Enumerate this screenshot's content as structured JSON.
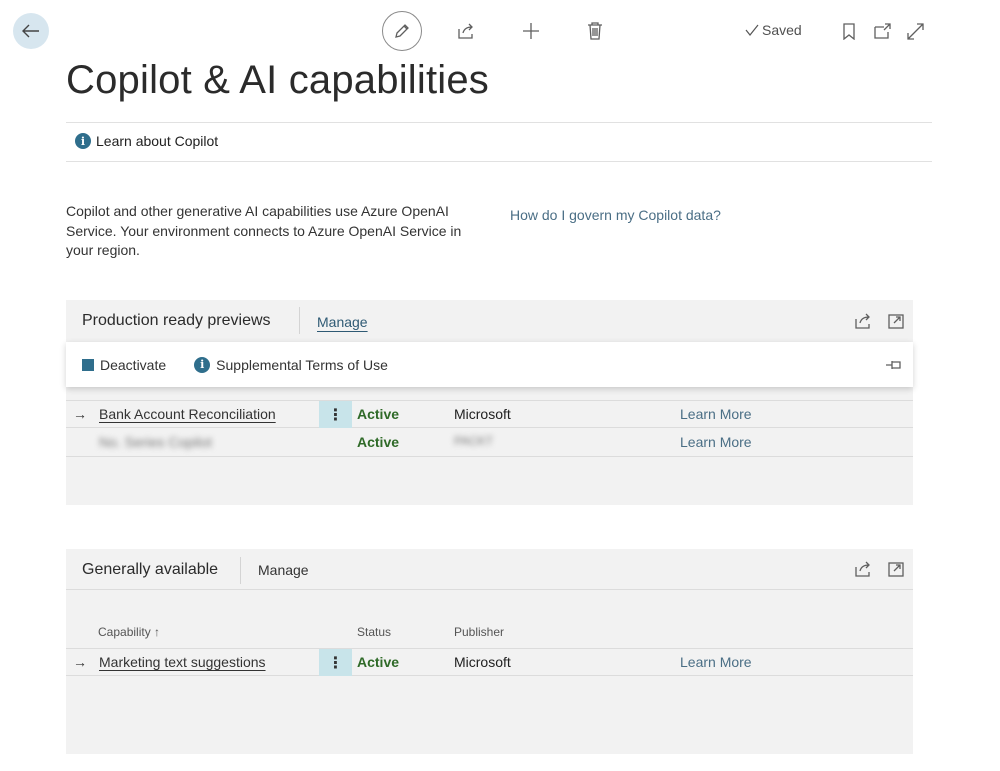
{
  "toolbar": {
    "back_icon": "arrow-left-icon",
    "edit_icon": "pencil-icon",
    "share_icon": "share-icon",
    "new_icon": "plus-icon",
    "delete_icon": "trash-icon",
    "saved_label": "Saved",
    "bookmark_icon": "bookmark-icon",
    "open_new_icon": "open-in-new-window-icon",
    "expand_icon": "expand-icon"
  },
  "page": {
    "title": "Copilot & AI capabilities",
    "learn_copilot": "Learn about Copilot",
    "description": "Copilot and other generative AI capabilities use Azure OpenAI Service. Your environment connects to Azure OpenAI Service in your region.",
    "govern_link": "How do I govern my Copilot data?"
  },
  "preview_part": {
    "title": "Production ready previews",
    "manage_label": "Manage",
    "actions": {
      "deactivate": "Deactivate",
      "terms": "Supplemental Terms of Use"
    },
    "rows": [
      {
        "capability": "Bank Account Reconciliation",
        "status": "Active",
        "publisher": "Microsoft",
        "learn_more": "Learn More"
      },
      {
        "capability": "No. Series Copilot",
        "status": "Active",
        "publisher": "PACKT",
        "learn_more": "Learn More"
      }
    ]
  },
  "ga_part": {
    "title": "Generally available",
    "manage_label": "Manage",
    "columns": {
      "capability": "Capability ↑",
      "status": "Status",
      "publisher": "Publisher"
    },
    "rows": [
      {
        "capability": "Marketing text suggestions",
        "status": "Active",
        "publisher": "Microsoft",
        "learn_more": "Learn More"
      }
    ]
  },
  "colors": {
    "accent": "#2f6e8c",
    "status_active": "#2f6a28",
    "link": "#4a6e85",
    "row_selected": "#c8e4ea"
  }
}
